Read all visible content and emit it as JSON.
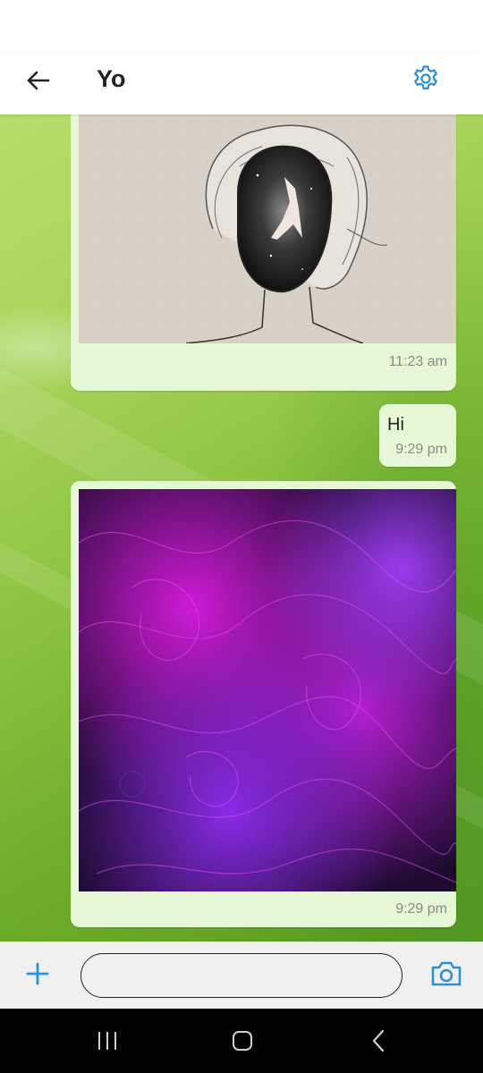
{
  "header": {
    "title": "Yo",
    "back_icon": "arrow-left-icon",
    "settings_icon": "gear-icon",
    "accent_color": "#2f8fd8"
  },
  "messages": [
    {
      "type": "image",
      "image": "sketch of woman with galaxy face",
      "time": "11:23 am"
    },
    {
      "type": "text",
      "text": "Hi",
      "time": "9:29 pm"
    },
    {
      "type": "image",
      "image": "purple swirling abstract art",
      "time": "9:29 pm"
    }
  ],
  "composer": {
    "add_icon": "plus-icon",
    "camera_icon": "camera-icon",
    "placeholder": ""
  },
  "navbar": {
    "recents_icon": "recent-apps-icon",
    "home_icon": "home-icon",
    "back_icon": "nav-back-icon"
  },
  "colors": {
    "bubble": "#e6f7d6",
    "chat_background": "#8fc441"
  }
}
